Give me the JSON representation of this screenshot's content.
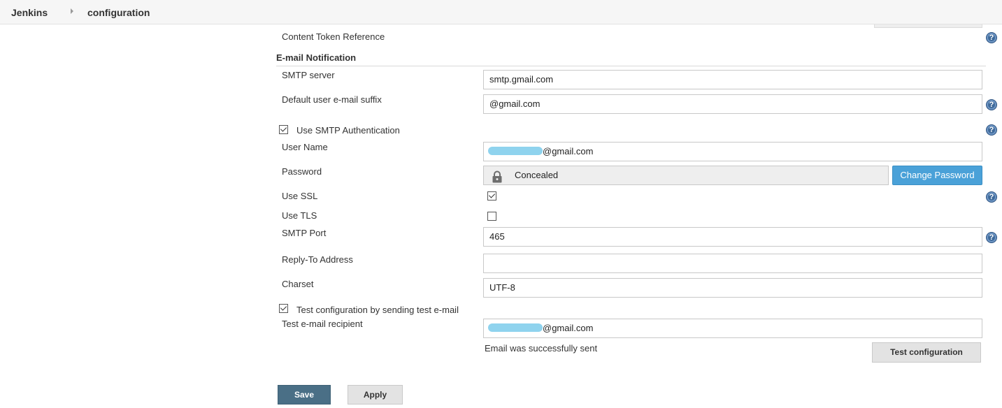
{
  "breadcrumb": {
    "home": "Jenkins",
    "current": "configuration"
  },
  "content_token": {
    "label": "Content Token Reference"
  },
  "section": {
    "title": "E-mail Notification"
  },
  "fields": {
    "smtp_server": {
      "label": "SMTP server",
      "value": "smtp.gmail.com"
    },
    "email_suffix": {
      "label": "Default user e-mail suffix",
      "value": "@gmail.com"
    },
    "smtp_auth": {
      "label": "Use SMTP Authentication",
      "checked": true
    },
    "username": {
      "label": "User Name",
      "value_suffix": "@gmail.com"
    },
    "password": {
      "label": "Password",
      "value": "Concealed",
      "change_button": "Change Password"
    },
    "use_ssl": {
      "label": "Use SSL",
      "checked": true
    },
    "use_tls": {
      "label": "Use TLS",
      "checked": false
    },
    "smtp_port": {
      "label": "SMTP Port",
      "value": "465"
    },
    "reply_to": {
      "label": "Reply-To Address",
      "value": ""
    },
    "charset": {
      "label": "Charset",
      "value": "UTF-8"
    },
    "test_config": {
      "label": "Test configuration by sending test e-mail",
      "checked": true
    },
    "test_recipient": {
      "label": "Test e-mail recipient",
      "value_suffix": "@gmail.com"
    }
  },
  "status_message": "Email was successfully sent",
  "buttons": {
    "test_configuration": "Test configuration",
    "save": "Save",
    "apply": "Apply"
  },
  "help_icon": "?",
  "icons": {
    "help": "question-circle-icon",
    "lock": "lock-icon",
    "breadcrumb_separator": "chevron-right-icon"
  },
  "colors": {
    "primary_button": "#4aa1d8",
    "save_button": "#4a6f86",
    "help_icon": "#3f6a9a",
    "redaction": "#8fd3ee"
  }
}
